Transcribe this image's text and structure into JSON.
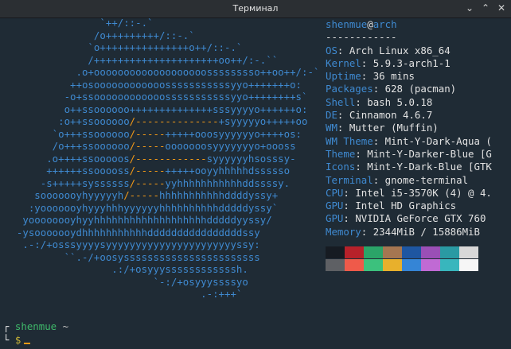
{
  "window": {
    "title": "Терминал"
  },
  "info": {
    "user": "shenmue",
    "at": "@",
    "host": "arch",
    "separator": "------------",
    "fields": [
      {
        "key": "OS",
        "value": " Arch Linux x86_64"
      },
      {
        "key": "Kernel",
        "value": " 5.9.3-arch1-1"
      },
      {
        "key": "Uptime",
        "value": " 36 mins"
      },
      {
        "key": "Packages",
        "value": " 628 (pacman)"
      },
      {
        "key": "Shell",
        "value": " bash 5.0.18"
      },
      {
        "key": "DE",
        "value": " Cinnamon 4.6.7"
      },
      {
        "key": "WM",
        "value": " Mutter (Muffin)"
      },
      {
        "key": "WM Theme",
        "value": " Mint-Y-Dark-Aqua ("
      },
      {
        "key": "Theme",
        "value": " Mint-Y-Darker-Blue [G"
      },
      {
        "key": "Icons",
        "value": " Mint-Y-Dark-Blue [GTK"
      },
      {
        "key": "Terminal",
        "value": " gnome-terminal"
      },
      {
        "key": "CPU",
        "value": " Intel i5-3570K (4) @ 4."
      },
      {
        "key": "GPU",
        "value": " Intel HD Graphics"
      },
      {
        "key": "GPU",
        "value": " NVIDIA GeForce GTX 760"
      },
      {
        "key": "Memory",
        "value": " 2344MiB / 15886MiB"
      }
    ]
  },
  "palette": {
    "row1": [
      "#161b22",
      "#b7212a",
      "#2ba468",
      "#a57651",
      "#1e56a1",
      "#9a4fb6",
      "#2a9aa3",
      "#d8d8d8"
    ],
    "row2": [
      "#5e6064",
      "#ef5a4a",
      "#3cc17d",
      "#e8b02c",
      "#3585d6",
      "#c06ad4",
      "#38b6bd",
      "#f6f6f6"
    ]
  },
  "prompt": {
    "user": "shenmue",
    "tilde": "~",
    "symbol": "$"
  },
  "colors": {
    "accent": "#3f8ad1",
    "orange": "#f49a17",
    "background": "#1f2b35"
  }
}
